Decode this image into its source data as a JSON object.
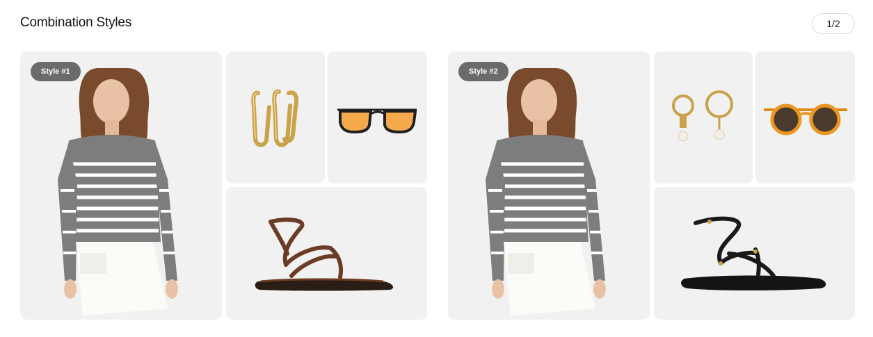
{
  "header": {
    "title": "Combination Styles"
  },
  "pagination": {
    "label": "1/2"
  },
  "styles": [
    {
      "badge": "Style #1",
      "model": "striped-top-model-photo",
      "earrings": "gold-hoop-earrings",
      "sunglasses": "orange-aviator-sunglasses",
      "shoes": "brown-strappy-sandals"
    },
    {
      "badge": "Style #2",
      "model": "striped-top-model-photo",
      "earrings": "pearl-drop-earrings",
      "sunglasses": "tortoise-round-sunglasses",
      "shoes": "black-strappy-sandals"
    }
  ]
}
